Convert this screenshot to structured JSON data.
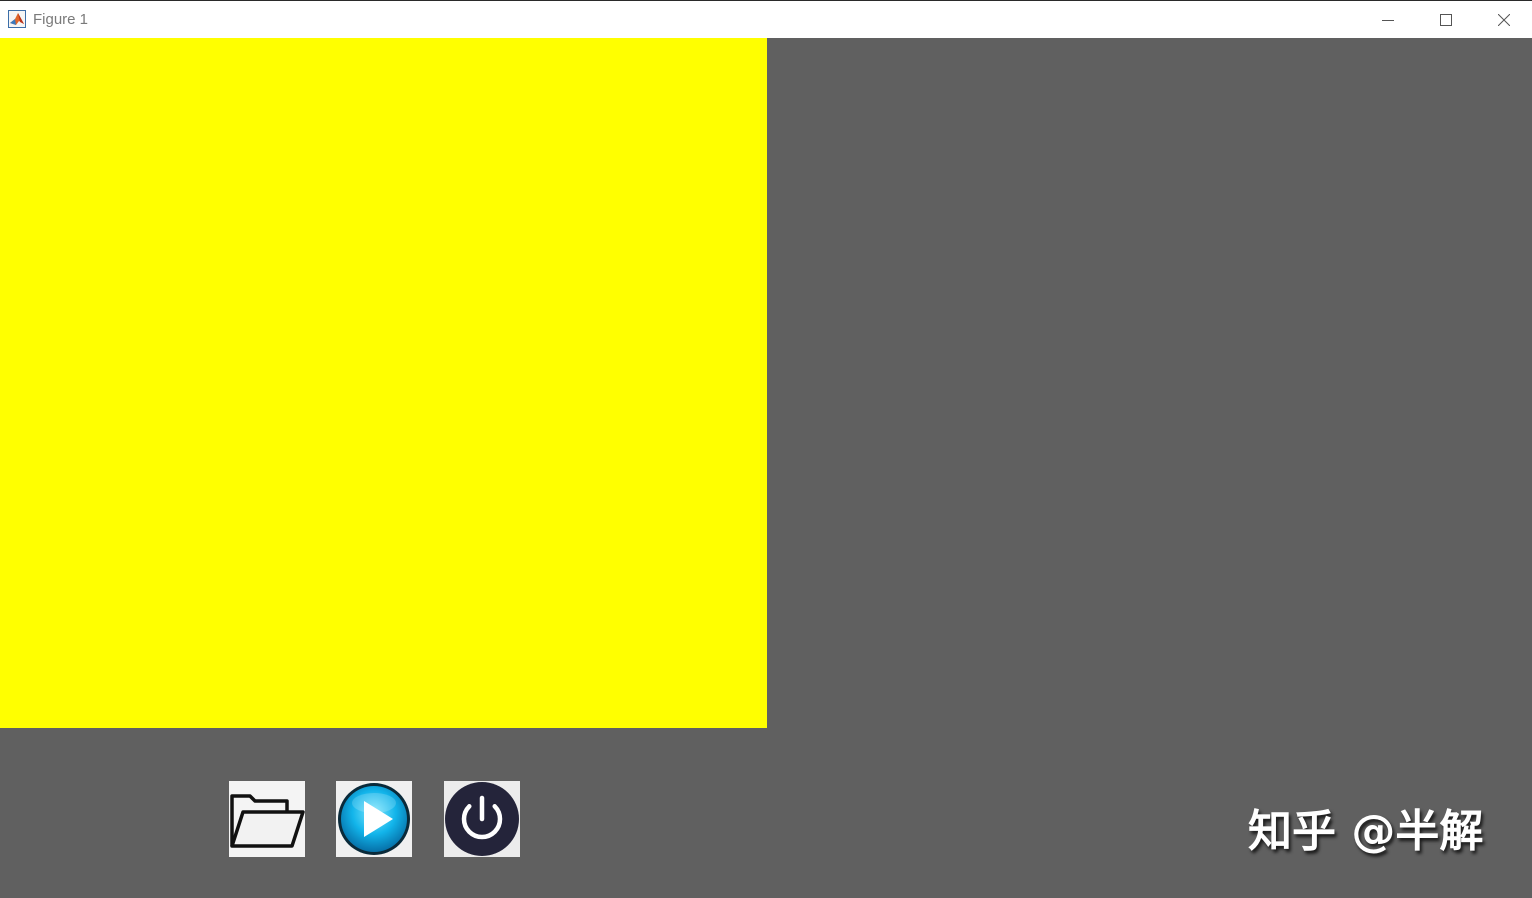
{
  "window": {
    "title": "Figure 1",
    "app_icon": "matlab-logo-icon",
    "controls": {
      "minimize_icon": "minimize-icon",
      "maximize_icon": "maximize-icon",
      "close_icon": "close-icon"
    }
  },
  "colors": {
    "figure_background": "#606060",
    "axes_background": "#ffff00",
    "titlebar_background": "#ffffff",
    "play_button_accent": "#00a8e8",
    "power_button_accent": "#24243a"
  },
  "toolbar": {
    "buttons": [
      {
        "icon": "open-folder-icon"
      },
      {
        "icon": "play-icon"
      },
      {
        "icon": "power-icon"
      }
    ]
  },
  "watermark": {
    "text": "知乎 @半解"
  }
}
